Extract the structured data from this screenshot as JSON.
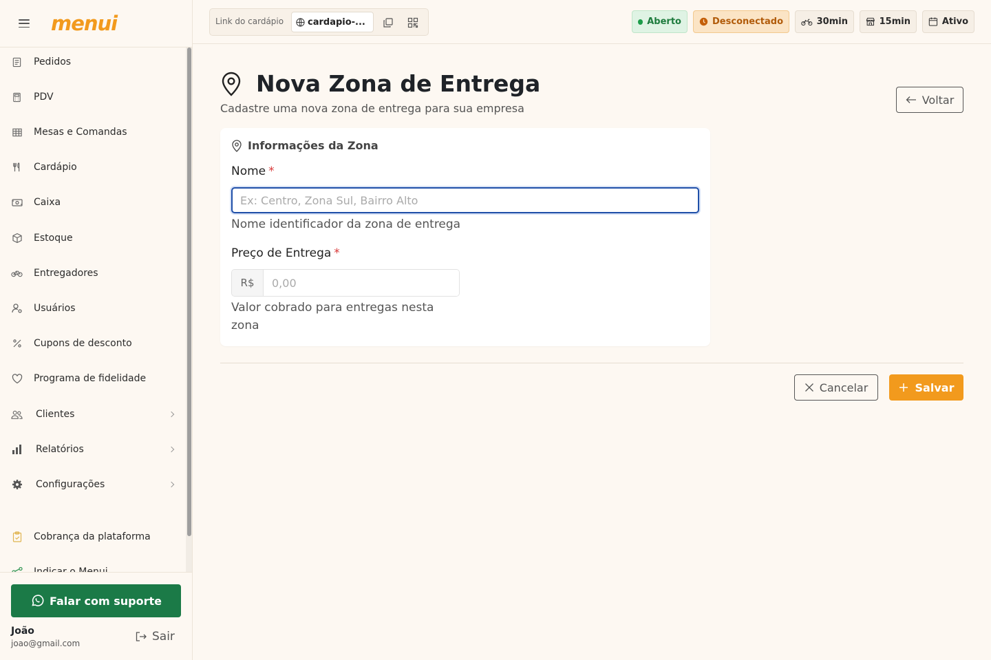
{
  "brand": {
    "logo": "menui",
    "accent": "#f29a1d",
    "support_green": "#1b7a47"
  },
  "sidebar": {
    "items": [
      {
        "label": "Pedidos",
        "icon": "receipt-icon"
      },
      {
        "label": "PDV",
        "icon": "calculator-icon"
      },
      {
        "label": "Mesas e Comandas",
        "icon": "table-icon"
      },
      {
        "label": "Cardápio",
        "icon": "utensils-icon"
      },
      {
        "label": "Caixa",
        "icon": "cash-icon"
      },
      {
        "label": "Estoque",
        "icon": "box-icon"
      },
      {
        "label": "Entregadores",
        "icon": "bike-icon"
      },
      {
        "label": "Usuários",
        "icon": "user-gear-icon"
      },
      {
        "label": "Cupons de desconto",
        "icon": "percent-icon"
      },
      {
        "label": "Programa de fidelidade",
        "icon": "heart-icon"
      },
      {
        "label": "Clientes",
        "icon": "users-icon"
      },
      {
        "label": "Relatórios",
        "icon": "bar-chart-icon"
      },
      {
        "label": "Configurações",
        "icon": "gear-icon"
      },
      {
        "label": "Cobrança da plataforma",
        "icon": "clipboard-icon"
      },
      {
        "label": "Indicar o Menui",
        "icon": "share-icon"
      }
    ],
    "support_label": "Falar com suporte",
    "user": {
      "name": "João",
      "email": "joao@gmail.com"
    },
    "logout_label": "Sair"
  },
  "topbar": {
    "link_label": "Link do cardápio",
    "link_value": "cardapio-...",
    "status_open": "Aberto",
    "status_connection": "Desconectado",
    "delivery_time": "30min",
    "pickup_time": "15min",
    "active_label": "Ativo"
  },
  "page": {
    "title": "Nova Zona de Entrega",
    "subtitle": "Cadastre uma nova zona de entrega para sua empresa",
    "back_label": "Voltar"
  },
  "form": {
    "section_title": "Informações da Zona",
    "name_label": "Nome",
    "name_placeholder": "Ex: Centro, Zona Sul, Bairro Alto",
    "name_value": "",
    "name_hint": "Nome identificador da zona de entrega",
    "price_label": "Preço de Entrega",
    "price_prefix": "R$",
    "price_placeholder": "0,00",
    "price_value": "",
    "price_hint": "Valor cobrado para entregas nesta zona",
    "required_mark": "*",
    "cancel_label": "Cancelar",
    "save_label": "Salvar"
  }
}
